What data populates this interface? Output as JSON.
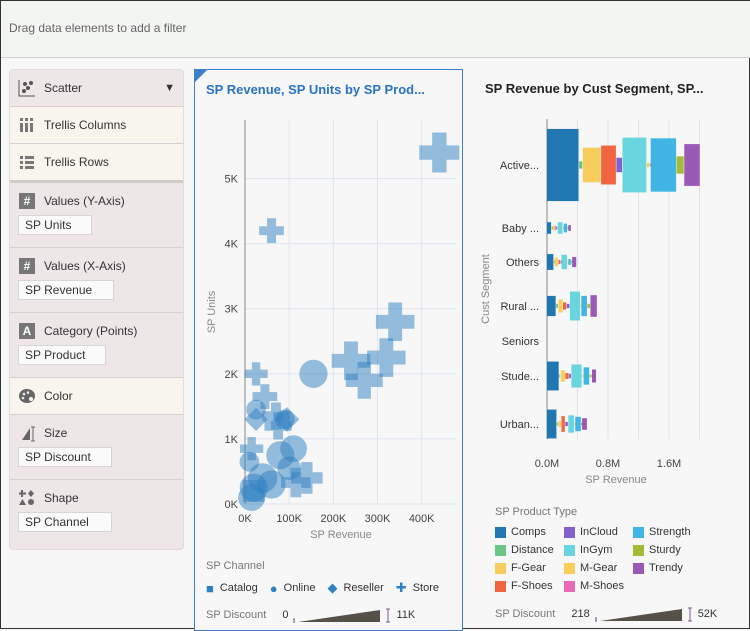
{
  "filter_bar": {
    "placeholder": "Drag data elements to add a filter"
  },
  "grammar": {
    "chart_type": "Scatter",
    "trellis_columns": "Trellis Columns",
    "trellis_rows": "Trellis Rows",
    "y_axis": {
      "label": "Values (Y-Axis)",
      "value": "SP Units"
    },
    "x_axis": {
      "label": "Values (X-Axis)",
      "value": "SP Revenue"
    },
    "category": {
      "label": "Category (Points)",
      "value": "SP Product"
    },
    "color": {
      "label": "Color"
    },
    "size": {
      "label": "Size",
      "value": "SP Discount"
    },
    "shape": {
      "label": "Shape",
      "value": "SP Channel"
    }
  },
  "chart_data": [
    {
      "type": "scatter",
      "title": "SP Revenue, SP Units by SP Prod...",
      "xlabel": "SP Revenue",
      "ylabel": "SP Units",
      "xticks": [
        "0K",
        "100K",
        "200K",
        "300K",
        "400K"
      ],
      "yticks": [
        "0K",
        "1K",
        "2K",
        "3K",
        "4K",
        "5K"
      ],
      "xlim": [
        0,
        480000
      ],
      "ylim": [
        0,
        5900
      ],
      "grid": true,
      "color": "#2f7fc1",
      "points": [
        {
          "x": 440000,
          "y": 5400,
          "shape": "Store",
          "size": 11000
        },
        {
          "x": 60000,
          "y": 4200,
          "shape": "Store",
          "size": 3000
        },
        {
          "x": 340000,
          "y": 2800,
          "shape": "Store",
          "size": 10000
        },
        {
          "x": 320000,
          "y": 2250,
          "shape": "Store",
          "size": 10000
        },
        {
          "x": 240000,
          "y": 2200,
          "shape": "Store",
          "size": 10000
        },
        {
          "x": 270000,
          "y": 1900,
          "shape": "Store",
          "size": 9000
        },
        {
          "x": 25000,
          "y": 2000,
          "shape": "Store",
          "size": 2500
        },
        {
          "x": 45000,
          "y": 1650,
          "shape": "Store",
          "size": 3000
        },
        {
          "x": 70000,
          "y": 1350,
          "shape": "Store",
          "size": 4000
        },
        {
          "x": 75000,
          "y": 1200,
          "shape": "Store",
          "size": 4000
        },
        {
          "x": 15000,
          "y": 850,
          "shape": "Store",
          "size": 2500
        },
        {
          "x": 140000,
          "y": 400,
          "shape": "Store",
          "size": 6000
        },
        {
          "x": 115000,
          "y": 330,
          "shape": "Store",
          "size": 5000
        },
        {
          "x": 155000,
          "y": 2000,
          "shape": "Online",
          "size": 8000
        },
        {
          "x": 25000,
          "y": 1450,
          "shape": "Online",
          "size": 3000
        },
        {
          "x": 90000,
          "y": 1300,
          "shape": "Online",
          "size": 3000
        },
        {
          "x": 110000,
          "y": 850,
          "shape": "Online",
          "size": 7000
        },
        {
          "x": 80000,
          "y": 750,
          "shape": "Online",
          "size": 8000
        },
        {
          "x": 100000,
          "y": 550,
          "shape": "Online",
          "size": 5000
        },
        {
          "x": 40000,
          "y": 400,
          "shape": "Online",
          "size": 9000
        },
        {
          "x": 60000,
          "y": 300,
          "shape": "Online",
          "size": 8000
        },
        {
          "x": 20000,
          "y": 250,
          "shape": "Online",
          "size": 8000
        },
        {
          "x": 15000,
          "y": 100,
          "shape": "Online",
          "size": 7000
        },
        {
          "x": 10000,
          "y": 650,
          "shape": "Online",
          "size": 3000
        },
        {
          "x": 25000,
          "y": 1300,
          "shape": "Reseller",
          "size": 2500
        },
        {
          "x": 95000,
          "y": 1300,
          "shape": "Reseller",
          "size": 3000
        },
        {
          "x": 20000,
          "y": 200,
          "shape": "Catalog",
          "size": 4000
        }
      ],
      "legend": {
        "title": "SP Channel",
        "items": [
          "Catalog",
          "Online",
          "Reseller",
          "Store"
        ]
      },
      "size_legend": {
        "label": "SP Discount",
        "min": "0",
        "max": "11K"
      }
    },
    {
      "type": "bar",
      "orientation": "horizontal",
      "stacked": true,
      "title": "SP Revenue by Cust Segment, SP...",
      "xlabel": "SP Revenue",
      "ylabel": "Cust Segment",
      "xticks": [
        "0.0M",
        "0.8M",
        "1.6M"
      ],
      "xlim": [
        0,
        2.3
      ],
      "categories": [
        "Active...",
        "Baby ...",
        "Others",
        "Rural ...",
        "Seniors",
        "Stude...",
        "Urban..."
      ],
      "products": [
        "Comps",
        "Distance",
        "F-Gear",
        "F-Shoes",
        "InCloud",
        "InGym",
        "M-Gear",
        "M-Shoes",
        "Strength",
        "Sturdy",
        "Trendy"
      ],
      "colors": {
        "Comps": "#2077b1",
        "Distance": "#6cc487",
        "F-Gear": "#f7cd5c",
        "F-Shoes": "#f1643f",
        "InCloud": "#8560cc",
        "InGym": "#6ad5de",
        "M-Gear": "#f7cd5c",
        "M-Shoes": "#e86bb8",
        "Strength": "#41b5e5",
        "Sturdy": "#a3bb36",
        "Trendy": "#9b59b6"
      },
      "values_M": [
        [
          0.42,
          0.05,
          0.24,
          0.2,
          0.08,
          0.32,
          0.04,
          0.01,
          0.34,
          0.1,
          0.21
        ],
        [
          0.06,
          0.01,
          0.03,
          0.02,
          0.02,
          0.07,
          0.01,
          0,
          0.05,
          0.01,
          0.04
        ],
        [
          0.09,
          0.01,
          0.05,
          0.03,
          0.01,
          0.08,
          0.01,
          0,
          0.04,
          0.01,
          0.06
        ],
        [
          0.12,
          0.03,
          0.06,
          0.05,
          0.04,
          0.14,
          0.01,
          0,
          0.08,
          0.04,
          0.09
        ],
        [
          0,
          0,
          0,
          0,
          0,
          0,
          0,
          0,
          0,
          0,
          0
        ],
        [
          0.16,
          0.02,
          0.06,
          0.05,
          0.03,
          0.14,
          0.02,
          0,
          0.08,
          0.03,
          0.06
        ],
        [
          0.13,
          0.02,
          0.04,
          0.05,
          0.04,
          0.08,
          0.01,
          0,
          0.08,
          0.01,
          0.07
        ]
      ],
      "discount_K": [
        [
          50,
          5,
          24,
          27,
          10,
          38,
          3,
          1,
          37,
          12,
          29
        ],
        [
          8,
          2,
          3,
          3,
          2,
          8,
          1,
          0,
          6,
          1,
          4
        ],
        [
          11,
          1,
          6,
          3,
          1,
          10,
          1,
          0,
          4,
          1,
          7
        ],
        [
          14,
          3,
          9,
          5,
          3,
          20,
          1,
          0,
          14,
          3,
          15
        ],
        [
          0,
          0,
          0,
          0,
          0,
          0,
          0,
          0,
          0,
          0,
          0
        ],
        [
          20,
          2,
          8,
          4,
          3,
          16,
          2,
          0,
          12,
          2,
          9
        ],
        [
          20,
          2,
          4,
          11,
          3,
          12,
          1,
          0,
          10,
          1,
          8
        ]
      ],
      "legend": {
        "title": "SP Product Type",
        "items": [
          "Comps",
          "InCloud",
          "Strength",
          "Distance",
          "InGym",
          "Sturdy",
          "F-Gear",
          "M-Gear",
          "Trendy",
          "F-Shoes",
          "M-Shoes"
        ]
      },
      "size_legend": {
        "label": "SP Discount",
        "min": "218",
        "max": "52K"
      }
    }
  ]
}
